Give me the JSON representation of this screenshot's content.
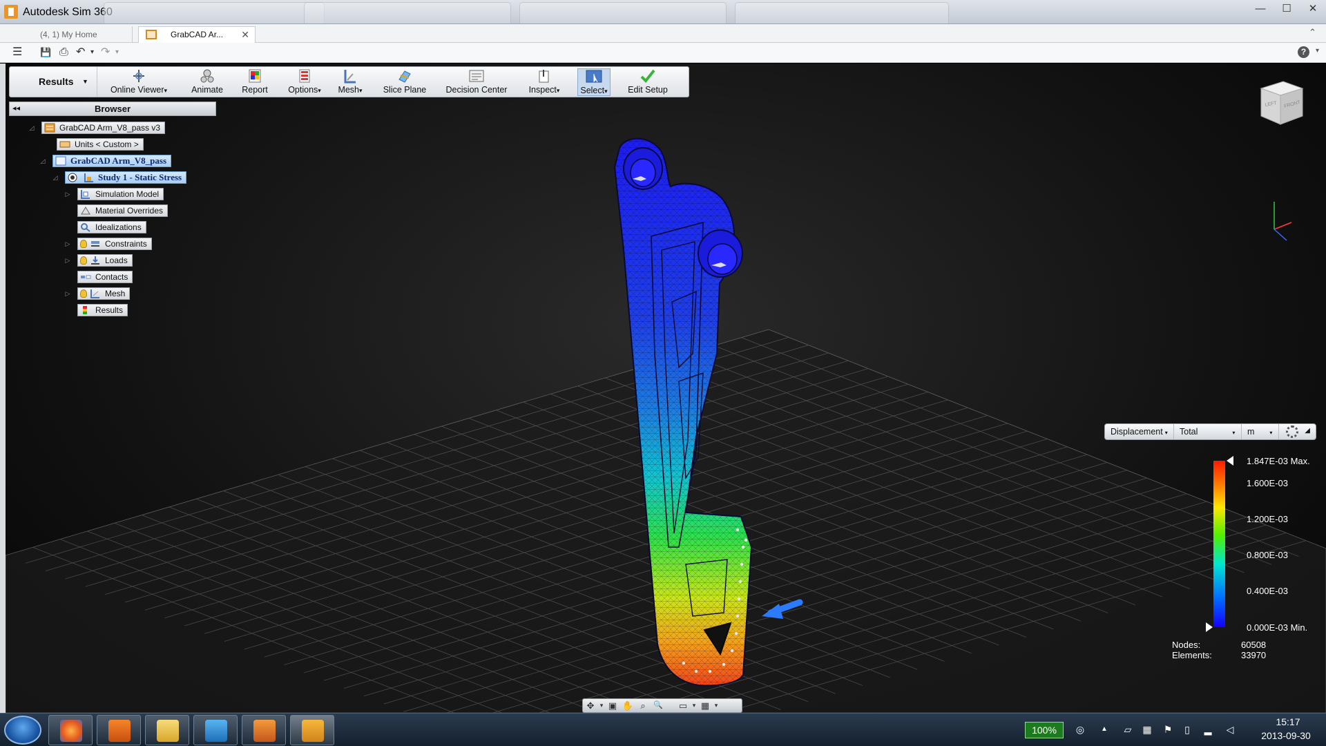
{
  "window": {
    "title": "Autodesk Sim 360",
    "browser_tabs": [
      "",
      "",
      "",
      ""
    ],
    "controls": {
      "minimize": "—",
      "maximize": "☐",
      "close": "✕"
    }
  },
  "doc_tabs": {
    "home_label": "(4, 1) My Home",
    "doc_label": "GrabCAD Ar...",
    "close_glyph": "✕",
    "help_chevron": "⌃"
  },
  "quick_access": {
    "menu": "☰",
    "save": "💾",
    "save_copy": "⎙",
    "undo": "↶",
    "undo_drop": "▾",
    "redo": "↷",
    "redo_drop": "▾",
    "help": "?",
    "help_drop": "▾"
  },
  "ribbon": {
    "results_label": "Results",
    "results_arrow": "▼",
    "buttons": {
      "online_viewer": "Online Viewer",
      "animate": "Animate",
      "report": "Report",
      "options": "Options",
      "mesh": "Mesh",
      "slice_plane": "Slice Plane",
      "decision_center": "Decision Center",
      "inspect": "Inspect",
      "select": "Select",
      "edit_setup": "Edit Setup"
    },
    "dropdown_glyph": "▾"
  },
  "browser": {
    "header": "Browser",
    "collapse_glyph": "◂◂",
    "expand_open": "◿",
    "expand_closed": "▷",
    "nodes": {
      "root": "GrabCAD Arm_V8_pass v3",
      "units": "Units < Custom >",
      "design": "GrabCAD Arm_V8_pass",
      "study": "Study 1 - Static Stress",
      "simulation_model": "Simulation Model",
      "material_overrides": "Material Overrides",
      "idealizations": "Idealizations",
      "constraints": "Constraints",
      "loads": "Loads",
      "contacts": "Contacts",
      "mesh": "Mesh",
      "results": "Results"
    }
  },
  "legend": {
    "quantity": "Displacement",
    "component": "Total",
    "unit": "m",
    "collapse": "◢",
    "labels": {
      "max": "1.847E-03 Max.",
      "l1600": "1.600E-03",
      "l1200": "1.200E-03",
      "l0800": "0.800E-03",
      "l0400": "0.400E-03",
      "min": "0.000E-03 Min."
    },
    "colors": {
      "high": "#ff1a00",
      "low": "#1400ff"
    },
    "nodes_label": "Nodes:",
    "nodes_value": "60508",
    "elements_label": "Elements:",
    "elements_value": "33970"
  },
  "viewcube": {
    "left_face": "LEFT",
    "front_face": "FRONT"
  },
  "navbar": {
    "pan": "✥",
    "pan_drop": "▾",
    "look": "▣",
    "orbit": "✋",
    "zoom_region": "⌕",
    "zoom": "🔍",
    "display": "▭",
    "display_drop": "▾",
    "grid": "▦",
    "grid_drop": "▾"
  },
  "taskbar": {
    "battery": "100%",
    "time": "15:17",
    "date": "2013-09-30",
    "tray_arrow": "▲"
  }
}
